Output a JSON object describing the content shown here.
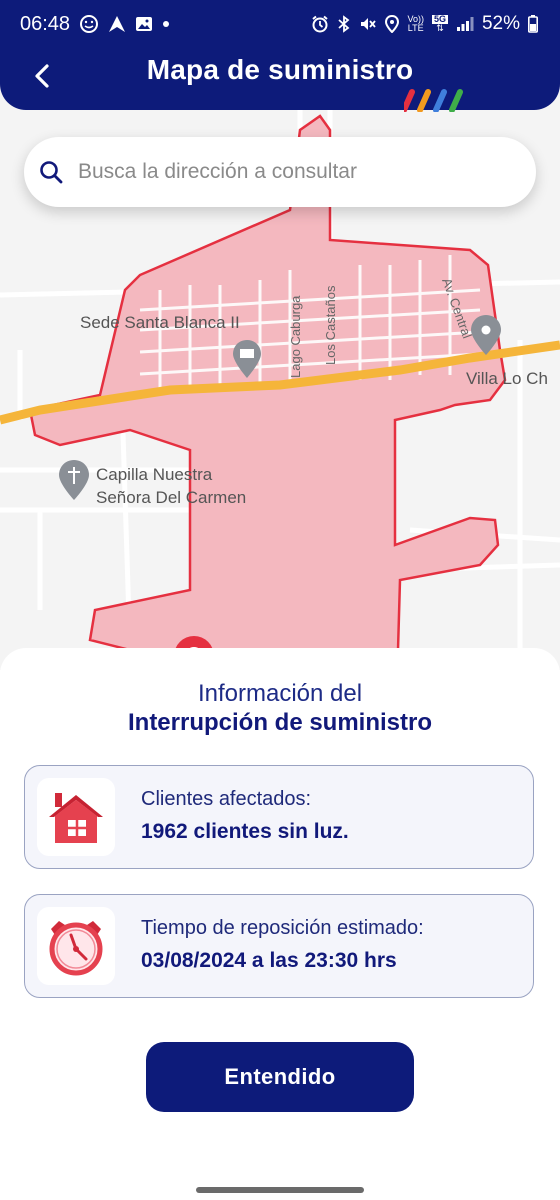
{
  "status_bar": {
    "time": "06:48",
    "battery": "52%",
    "network_top": "Vo))",
    "network_bottom": "LTE",
    "badge_5g": "5G"
  },
  "app_bar": {
    "title": "Mapa de suministro"
  },
  "search": {
    "placeholder": "Busca la dirección a consultar"
  },
  "map": {
    "labels": {
      "sede": "Sede Santa Blanca II",
      "lago": "Lago Caburga",
      "castanos": "Los Castaños",
      "central": "Av. Central",
      "villa": "Villa Lo Ch",
      "capilla1": "Capilla Nuestra",
      "capilla2": "Señora Del Carmen"
    },
    "outage_fill": "#f4b8bf",
    "outage_stroke": "#e53040",
    "road_color": "#f5b53a"
  },
  "info": {
    "title_line1": "Información del",
    "title_line2": "Interrupción de suministro",
    "cards": [
      {
        "icon": "house-icon",
        "label": "Clientes afectados:",
        "value": "1962 clientes sin luz."
      },
      {
        "icon": "clock-icon",
        "label": "Tiempo de reposición estimado:",
        "value": "03/08/2024 a las 23:30 hrs"
      }
    ]
  },
  "button": {
    "label": "Entendido"
  },
  "colors": {
    "brand": "#0d1b7a",
    "accent_red": "#e53040"
  }
}
